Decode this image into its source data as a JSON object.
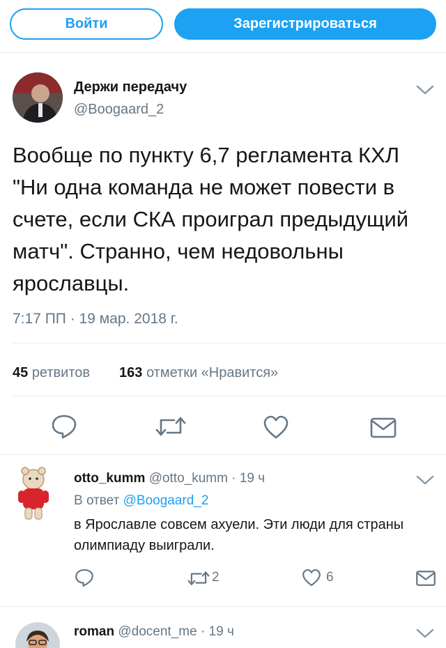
{
  "header": {
    "login_label": "Войти",
    "signup_label": "Зарегистрироваться",
    "accent": "#1da1f2"
  },
  "tweet": {
    "author_name": "Держи передачу",
    "author_handle": "@Boogaard_2",
    "text": "Вообще по пункту 6,7 регламента КХЛ \"Ни одна команда не может повести в счете, если СКА проиграл предыдущий матч\". Странно, чем недовольны ярославцы.",
    "time": "7:17 ПП · 19 мар. 2018 г.",
    "retweets_count": "45",
    "retweets_label": "ретвитов",
    "likes_count": "163",
    "likes_label": "отметки «Нравится»",
    "icons": [
      "reply-icon",
      "retweet-icon",
      "like-icon",
      "message-icon",
      "chevron-down-icon"
    ]
  },
  "replies": [
    {
      "author_name": "otto_kumm",
      "author_handle": "@otto_kumm",
      "time": "· 19 ч",
      "reply_to_prefix": "В ответ",
      "reply_to_handle": "@Boogaard_2",
      "text": "в Ярославле совсем ахуели. Эти люди для страны олимпиаду выиграли.",
      "retweet_count": "2",
      "like_count": "6"
    },
    {
      "author_name": "roman",
      "author_handle": "@docent_me",
      "time": "· 19 ч"
    }
  ]
}
